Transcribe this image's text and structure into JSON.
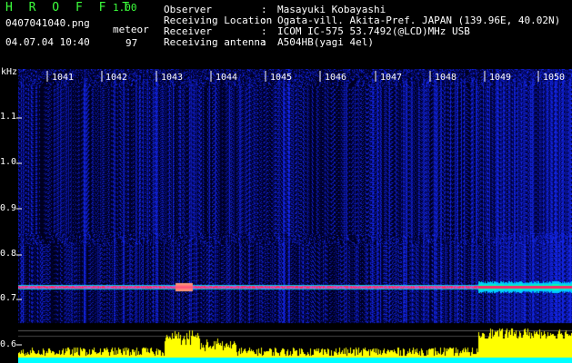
{
  "header": {
    "app_title": "H R O F F T",
    "version": "1.00",
    "filename": "0407041040.png",
    "timestamp": "04.07.04 10:40",
    "meteor_label": "meteor",
    "meteor_count": "97"
  },
  "info": [
    {
      "key": "Observer",
      "sep": ":",
      "value": "Masayuki Kobayashi"
    },
    {
      "key": "Receiving Location",
      "sep": ":",
      "value": "Ogata-vill. Akita-Pref. JAPAN (139.96E, 40.02N)"
    },
    {
      "key": "Receiver",
      "sep": ":",
      "value": "ICOM IC-575 53.7492(@LCD)MHz USB"
    },
    {
      "key": "Receiving antenna",
      "sep": ":",
      "value": "A504HB(yagi 4el)"
    }
  ],
  "spectrogram": {
    "y_unit": "kHz",
    "y_ticks": [
      "1.1",
      "1.0",
      "0.9",
      "0.8",
      "0.7",
      "0.6"
    ],
    "time_ticks": [
      "1041",
      "1042",
      "1043",
      "1044",
      "1045",
      "1046",
      "1047",
      "1048",
      "1049",
      "1050"
    ],
    "carrier_khz": 0.73,
    "colors": {
      "background": "#000000",
      "noise": "#1a2a9a",
      "carrier": "#ff2a60",
      "signal_bar": "#ffff00",
      "baseline": "#00ffff",
      "labels_green": "#3cff3c"
    }
  }
}
